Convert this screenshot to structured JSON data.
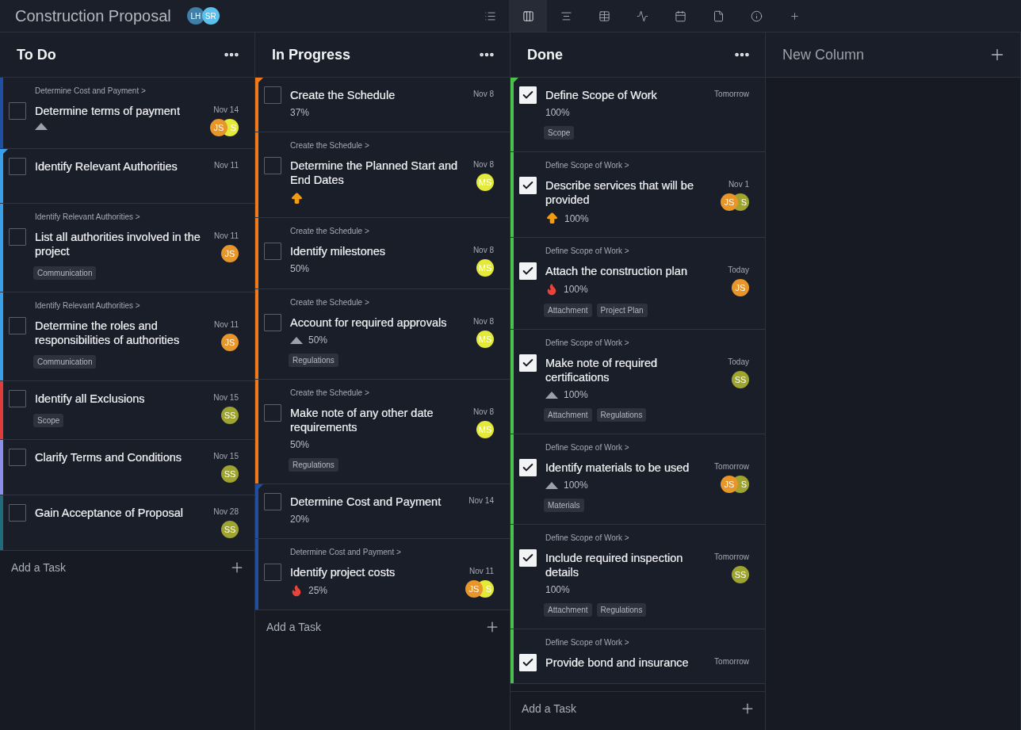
{
  "project": {
    "title": "Construction Proposal",
    "members": [
      {
        "initials": "LH",
        "color": "#3f7ea6"
      },
      {
        "initials": "SR",
        "color": "#5bc0eb"
      }
    ]
  },
  "views": [
    {
      "kind": "list",
      "selected": false
    },
    {
      "kind": "board",
      "selected": true
    },
    {
      "kind": "gantt",
      "selected": false
    },
    {
      "kind": "table",
      "selected": false
    },
    {
      "kind": "pulse",
      "selected": false
    },
    {
      "kind": "calendar",
      "selected": false
    },
    {
      "kind": "file",
      "selected": false
    },
    {
      "kind": "alert",
      "selected": false
    },
    {
      "kind": "add",
      "selected": false
    }
  ],
  "columns": [
    {
      "title": "To Do",
      "kind": "list",
      "add_label": "Add a Task",
      "cards": [
        {
          "parent": "Determine Cost and Payment >",
          "title": "Determine terms of payment",
          "date": "Nov 14",
          "checked": false,
          "corner": false,
          "color": "#1e4fa0",
          "priority": {
            "kind": "low"
          },
          "avatars": [
            {
              "initials": "JS",
              "color": "#e8952a"
            },
            {
              "initials": "S",
              "color": "#e3ea3a"
            }
          ]
        },
        {
          "title": "Identify Relevant Authorities",
          "date": "Nov 11",
          "checked": false,
          "corner": true,
          "color": "#3a9ee8"
        },
        {
          "parent": "Identify Relevant Authorities >",
          "title": "List all authorities involved in the project",
          "date": "Nov 11",
          "checked": false,
          "corner": false,
          "color": "#3a9ee8",
          "avatars": [
            {
              "initials": "JS",
              "color": "#e8952a"
            }
          ],
          "tags": [
            "Communication"
          ]
        },
        {
          "parent": "Identify Relevant Authorities >",
          "title": "Determine the roles and responsibilities of authorities",
          "date": "Nov 11",
          "checked": false,
          "corner": false,
          "color": "#3a9ee8",
          "avatars": [
            {
              "initials": "JS",
              "color": "#e8952a"
            }
          ],
          "tags": [
            "Communication"
          ]
        },
        {
          "title": "Identify all Exclusions",
          "date": "Nov 15",
          "checked": false,
          "corner": false,
          "color": "#e03c3c",
          "avatars": [
            {
              "initials": "SS",
              "color": "#9ea42f"
            }
          ],
          "tags": [
            "Scope"
          ]
        },
        {
          "title": "Clarify Terms and Conditions",
          "date": "Nov 15",
          "checked": false,
          "corner": false,
          "color": "#8b8fe8",
          "avatars": [
            {
              "initials": "SS",
              "color": "#9ea42f"
            }
          ]
        },
        {
          "title": "Gain Acceptance of Proposal",
          "date": "Nov 28",
          "checked": false,
          "corner": false,
          "color": "#1f6b7a",
          "avatars": [
            {
              "initials": "SS",
              "color": "#9ea42f"
            }
          ]
        }
      ]
    },
    {
      "title": "In Progress",
      "kind": "list",
      "add_label": "Add a Task",
      "cards": [
        {
          "title": "Create the Schedule",
          "date": "Nov 8",
          "checked": false,
          "corner": true,
          "color": "#f07a18",
          "progress": "37%"
        },
        {
          "parent": "Create the Schedule >",
          "title": "Determine the Planned Start and End Dates",
          "date": "Nov 8",
          "checked": false,
          "corner": false,
          "color": "#f07a18",
          "priority": {
            "kind": "high"
          },
          "avatars": [
            {
              "initials": "MS",
              "color": "#e3ea3a"
            }
          ]
        },
        {
          "parent": "Create the Schedule >",
          "title": "Identify milestones",
          "date": "Nov 8",
          "checked": false,
          "corner": false,
          "color": "#f07a18",
          "progress": "50%",
          "avatars": [
            {
              "initials": "MS",
              "color": "#e3ea3a"
            }
          ]
        },
        {
          "parent": "Create the Schedule >",
          "title": "Account for required approvals",
          "date": "Nov 8",
          "checked": false,
          "corner": false,
          "color": "#f07a18",
          "priority": {
            "kind": "low"
          },
          "progress": "50%",
          "avatars": [
            {
              "initials": "MS",
              "color": "#e3ea3a"
            }
          ],
          "tags": [
            "Regulations"
          ]
        },
        {
          "parent": "Create the Schedule >",
          "title": "Make note of any other date requirements",
          "date": "Nov 8",
          "checked": false,
          "corner": false,
          "color": "#f07a18",
          "progress": "50%",
          "avatars": [
            {
              "initials": "MS",
              "color": "#e3ea3a"
            }
          ],
          "tags": [
            "Regulations"
          ]
        },
        {
          "title": "Determine Cost and Payment",
          "date": "Nov 14",
          "checked": false,
          "corner": true,
          "color": "#1e4fa0",
          "progress": "20%"
        },
        {
          "parent": "Determine Cost and Payment >",
          "title": "Identify project costs",
          "date": "Nov 11",
          "checked": false,
          "corner": false,
          "color": "#1e4fa0",
          "priority": {
            "kind": "critical"
          },
          "progress": "25%",
          "avatars": [
            {
              "initials": "JS",
              "color": "#e8952a"
            },
            {
              "initials": "S",
              "color": "#e3ea3a"
            }
          ]
        }
      ]
    },
    {
      "title": "Done",
      "kind": "list",
      "add_label": "Add a Task",
      "cards": [
        {
          "title": "Define Scope of Work",
          "date": "Tomorrow",
          "checked": true,
          "corner": true,
          "color": "#4cc04c",
          "progress": "100%",
          "tags": [
            "Scope"
          ]
        },
        {
          "parent": "Define Scope of Work >",
          "title": "Describe services that will be provided",
          "date": "Nov 1",
          "checked": true,
          "corner": false,
          "color": "#4cc04c",
          "priority": {
            "kind": "high"
          },
          "progress": "100%",
          "avatars": [
            {
              "initials": "JS",
              "color": "#e8952a"
            },
            {
              "initials": "S",
              "color": "#9ea42f"
            }
          ]
        },
        {
          "parent": "Define Scope of Work >",
          "title": "Attach the construction plan",
          "date": "Today",
          "checked": true,
          "corner": false,
          "color": "#4cc04c",
          "priority": {
            "kind": "critical"
          },
          "progress": "100%",
          "avatars": [
            {
              "initials": "JS",
              "color": "#e8952a"
            }
          ],
          "tags": [
            "Attachment",
            "Project Plan"
          ]
        },
        {
          "parent": "Define Scope of Work >",
          "title": "Make note of required certifications",
          "date": "Today",
          "checked": true,
          "corner": false,
          "color": "#4cc04c",
          "priority": {
            "kind": "low"
          },
          "progress": "100%",
          "avatars": [
            {
              "initials": "SS",
              "color": "#9ea42f"
            }
          ],
          "tags": [
            "Attachment",
            "Regulations"
          ]
        },
        {
          "parent": "Define Scope of Work >",
          "title": "Identify materials to be used",
          "date": "Tomorrow",
          "checked": true,
          "corner": false,
          "color": "#4cc04c",
          "priority": {
            "kind": "low"
          },
          "progress": "100%",
          "avatars": [
            {
              "initials": "JS",
              "color": "#e8952a"
            },
            {
              "initials": "S",
              "color": "#9ea42f"
            }
          ],
          "tags": [
            "Materials"
          ]
        },
        {
          "parent": "Define Scope of Work >",
          "title": "Include required inspection details",
          "date": "Tomorrow",
          "checked": true,
          "corner": false,
          "color": "#4cc04c",
          "progress": "100%",
          "avatars": [
            {
              "initials": "SS",
              "color": "#9ea42f"
            }
          ],
          "tags": [
            "Attachment",
            "Regulations"
          ]
        },
        {
          "parent": "Define Scope of Work >",
          "title": "Provide bond and insurance",
          "date": "Tomorrow",
          "checked": true,
          "corner": false,
          "color": "#4cc04c"
        }
      ]
    },
    {
      "title": "New Column",
      "kind": "new"
    }
  ]
}
